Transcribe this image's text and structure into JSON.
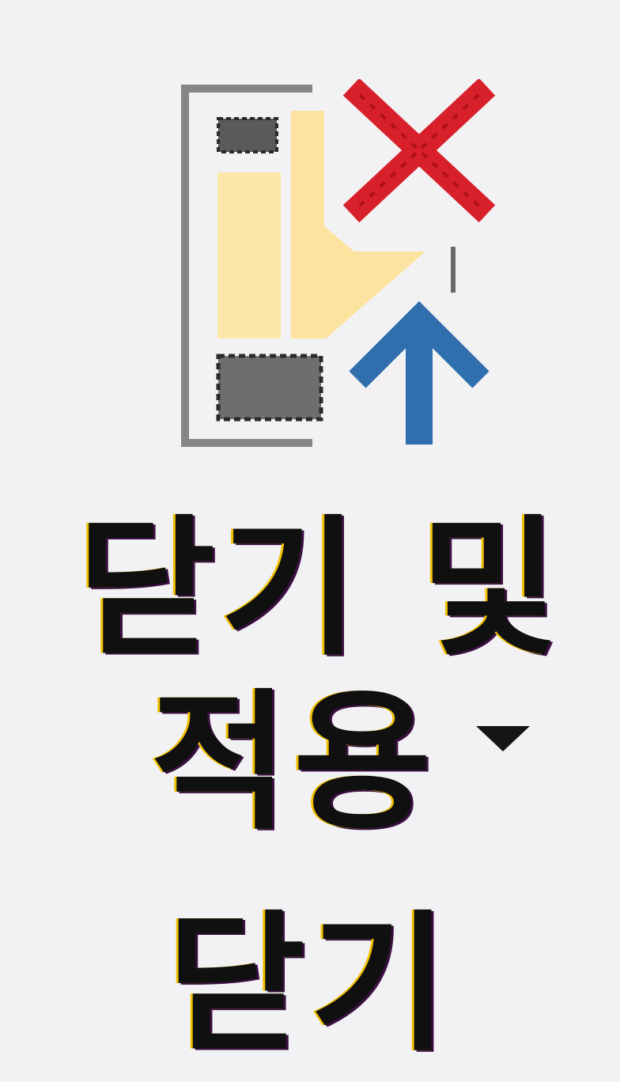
{
  "ribbon": {
    "group": {
      "label": "닫기",
      "button": {
        "label_line1": "닫기 및",
        "label_line2": "적용",
        "icon": "close-and-apply-icon",
        "has_dropdown": true
      }
    }
  },
  "colors": {
    "background": "#f2f2f4",
    "text": "#101010",
    "close_x": "#d4202a",
    "apply_arrow": "#2f6fae",
    "panel_fill": "#fde7a8",
    "frame": "#808080"
  }
}
